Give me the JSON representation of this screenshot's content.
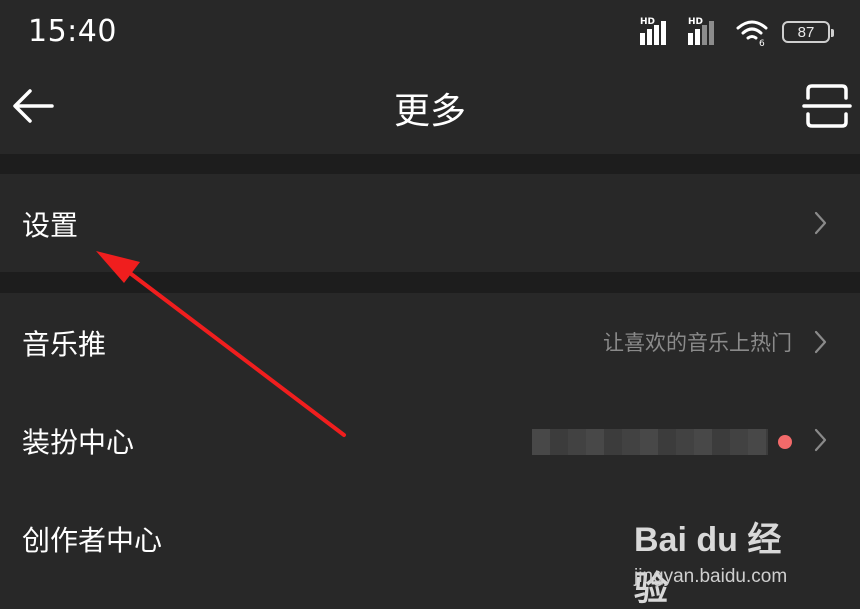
{
  "status_bar": {
    "time": "15:40",
    "signal_1_label": "HD",
    "signal_2_label": "HD",
    "wifi_label": "6",
    "battery_level": "87"
  },
  "nav": {
    "title": "更多",
    "back_icon": "back-arrow-icon",
    "scan_icon": "scan-icon"
  },
  "menu": {
    "settings": {
      "label": "设置"
    },
    "items": [
      {
        "label": "音乐推",
        "subtitle": "让喜欢的音乐上热门"
      },
      {
        "label": "装扮中心",
        "subtitle": "",
        "has_badge": true
      },
      {
        "label": "创作者中心",
        "subtitle": ""
      }
    ]
  },
  "annotation": {
    "type": "red-arrow",
    "color": "#f01e1e",
    "points_to": "设置"
  },
  "watermark": {
    "brand": "Bai du 经验",
    "url": "jingyan.baidu.com"
  },
  "colors": {
    "background": "#1d1d1d",
    "row_background": "#282828",
    "text": "#ffffff",
    "subtext": "#8a8a8a",
    "badge": "#f26a6a"
  }
}
